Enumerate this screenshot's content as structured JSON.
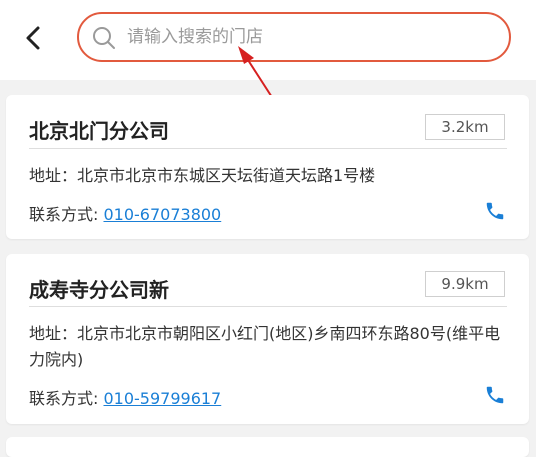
{
  "search": {
    "placeholder": "请输入搜索的门店"
  },
  "stores": [
    {
      "name": "北京北门分公司",
      "distance": "3.2km",
      "address": "地址：北京市北京市东城区天坛街道天坛路1号楼",
      "contact_label": "联系方式: ",
      "phone": "010-67073800"
    },
    {
      "name": "成寿寺分公司新",
      "distance": "9.9km",
      "address": "地址：北京市北京市朝阳区小红门(地区)乡南四环东路80号(维平电力院内)",
      "contact_label": "联系方式: ",
      "phone": "010-59799617"
    }
  ],
  "colors": {
    "accent": "#e25a3e",
    "link": "#1a7fd6",
    "annotation_arrow": "#d62020"
  }
}
